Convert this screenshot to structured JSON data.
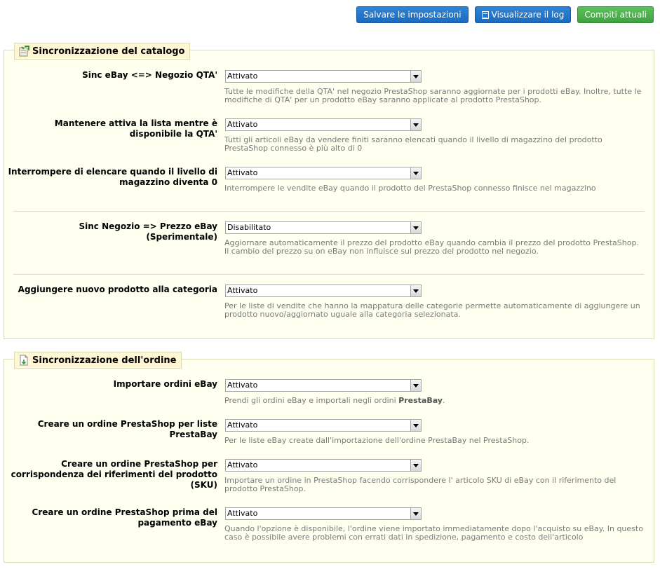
{
  "toolbar": {
    "save_label": "Salvare le impostazioni",
    "log_label": "Visualizzare il log",
    "tasks_label": "Compiti attuali"
  },
  "catalog": {
    "title": "Sincronizzazione del catalogo",
    "rows": [
      {
        "label": "Sinc eBay <=> Negozio QTA'",
        "value": "Attivato",
        "desc": "Tutte le modifiche della QTA' nel negozio PrestaShop saranno aggiornate per i prodotti eBay. Inoltre, tutte le modifiche di QTA' per un prodotto eBay saranno applicate al prodotto PrestaShop."
      },
      {
        "label": "Mantenere attiva la lista mentre è disponibile la QTA'",
        "value": "Attivato",
        "desc": "Tutti gli articoli eBay da vendere finiti saranno elencati quando il livello di magazzino del prodotto PrestaShop connesso è più alto di 0"
      },
      {
        "label": "Interrompere di elencare quando il livello di magazzino diventa 0",
        "value": "Attivato",
        "desc": "Interrompere le vendite eBay quando il prodotto del PrestaShop connesso finisce nel magazzino"
      },
      {
        "label": "Sinc Negozio => Prezzo eBay (Sperimentale)",
        "value": "Disabilitato",
        "desc": "Aggiornare automaticamente il prezzo del prodotto eBay quando cambia il prezzo del prodotto PrestaShop. Il cambio del prezzo su on eBay non influisce sul prezzo del prodotto nel negozio."
      },
      {
        "label": "Aggiungere nuovo prodotto alla categoria",
        "value": "Attivato",
        "desc": "Per le liste di vendite che hanno la mappatura delle categorie permette automaticamente di aggiungere un prodotto nuovo/aggiornato uguale alla categoria selezionata."
      }
    ]
  },
  "orders": {
    "title": "Sincronizzazione dell'ordine",
    "rows": [
      {
        "label": "Importare ordini eBay",
        "value": "Attivato",
        "desc_pre": "Prendi gli ordini eBay e importali negli ordini ",
        "desc_bold": "PrestaBay",
        "desc_post": "."
      },
      {
        "label": "Creare un ordine PrestaShop per liste PrestaBay",
        "value": "Attivato",
        "desc": "Per le liste eBay create dall'importazione dell'ordine PrestaBay nel PrestaShop."
      },
      {
        "label": "Creare un ordine PrestaShop per corrispondenza dei riferimenti del prodotto (SKU)",
        "value": "Attivato",
        "desc": "Importare un ordine in PrestaShop facendo corrispondere l' articolo SKU di eBay con il riferimento del prodotto PrestaShop."
      },
      {
        "label": "Creare un ordine PrestaShop prima del pagamento eBay",
        "value": "Attivato",
        "desc": "Quando l'opzione è disponibile, l'ordine viene importato immediatamente dopo l'acquisto su eBay. In questo caso è possibile avere problemi con errati dati in spedizione, pagamento e costo dell'articolo"
      }
    ]
  }
}
